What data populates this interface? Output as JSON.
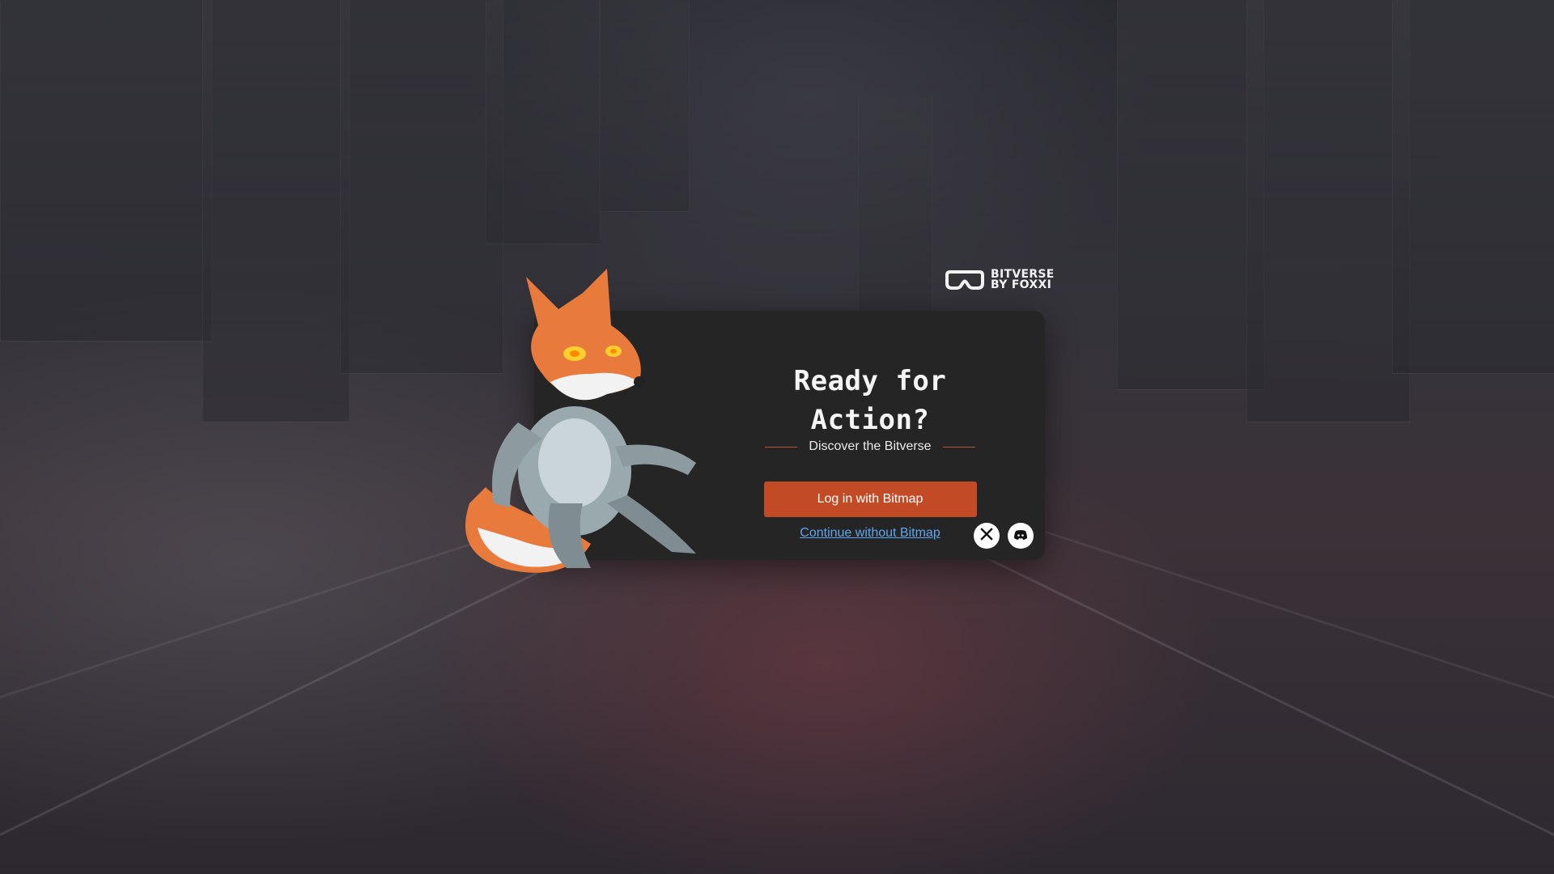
{
  "brand": {
    "line1": "BITVERSE",
    "line2": "BY FOXXI",
    "icon": "bitverse-logo-icon"
  },
  "card": {
    "title": "Ready for Action?",
    "subtitle": "Discover the Bitverse",
    "primary_button": "Log in with Bitmap",
    "secondary_link": "Continue without Bitmap"
  },
  "social": [
    {
      "icon": "x-icon"
    },
    {
      "icon": "discord-icon"
    }
  ],
  "colors": {
    "accent": "#c24a25",
    "link": "#5fa6ee",
    "card_bg": "#252525"
  },
  "mascot": {
    "icon": "robot-fox-mascot"
  }
}
